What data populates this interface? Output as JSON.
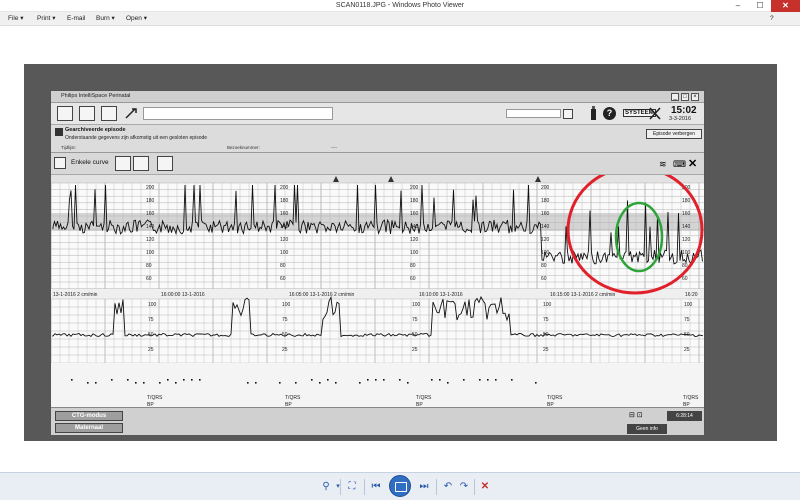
{
  "window": {
    "title": "SCAN0118.JPG - Windows Photo Viewer",
    "controls": [
      "–",
      "☐",
      "✕"
    ]
  },
  "menu": {
    "items": [
      {
        "label": "File",
        "arrow": "▾"
      },
      {
        "label": "Print",
        "arrow": "▾"
      },
      {
        "label": "E-mail",
        "arrow": ""
      },
      {
        "label": "Burn",
        "arrow": "▾"
      },
      {
        "label": "Open",
        "arrow": "▾"
      }
    ]
  },
  "app": {
    "title": "Philips IntelliSpace Perinatal",
    "title_buttons": [
      "_",
      "□",
      "×"
    ],
    "time": "15:02",
    "date": "3-3-2016",
    "systeem": "SYSTEEM",
    "episode_title": "Gearchiveerde episode",
    "episode_desc": "Onderstaande gegevens zijn afkomstig uit een gesloten episode",
    "episode_fields": [
      "Tijdlijst:",
      "Bezoeknummer:",
      "----"
    ],
    "episode_hide": "Episode verbergen",
    "curve_label": "Enkele curve",
    "bottom_buttons": [
      "CTG-modus",
      "Maternaal"
    ],
    "geen_info": "Geen info",
    "timestamp": "6:28:14"
  },
  "ctg_labels": {
    "fhr_ticks": [
      "200",
      "180",
      "160",
      "140",
      "120",
      "100",
      "80",
      "60"
    ],
    "toco_ticks": [
      "100",
      "75",
      "50",
      "25"
    ],
    "timestamps": [
      "13-1-2016   2 cm/min",
      "16:00:00   13-1-2016",
      "16:05:00   13-1-2016   2 cm/min",
      "16:10:00   13-1-2016",
      "16:15:00   13-1-2016   2 cm/min",
      "16:20"
    ],
    "bp_label": "BP",
    "tqrs_label": "T/QRS"
  },
  "colors": {
    "annotation_outer": "#e0202a",
    "annotation_inner": "#2ea33a",
    "scan_background": "#585858",
    "trace": "#111111"
  },
  "bottom_toolbar": {
    "tools": [
      "zoom-icon",
      "fit-icon",
      "previous-icon",
      "slideshow-icon",
      "next-icon",
      "rotate-left-icon",
      "rotate-right-icon",
      "delete-icon"
    ]
  }
}
